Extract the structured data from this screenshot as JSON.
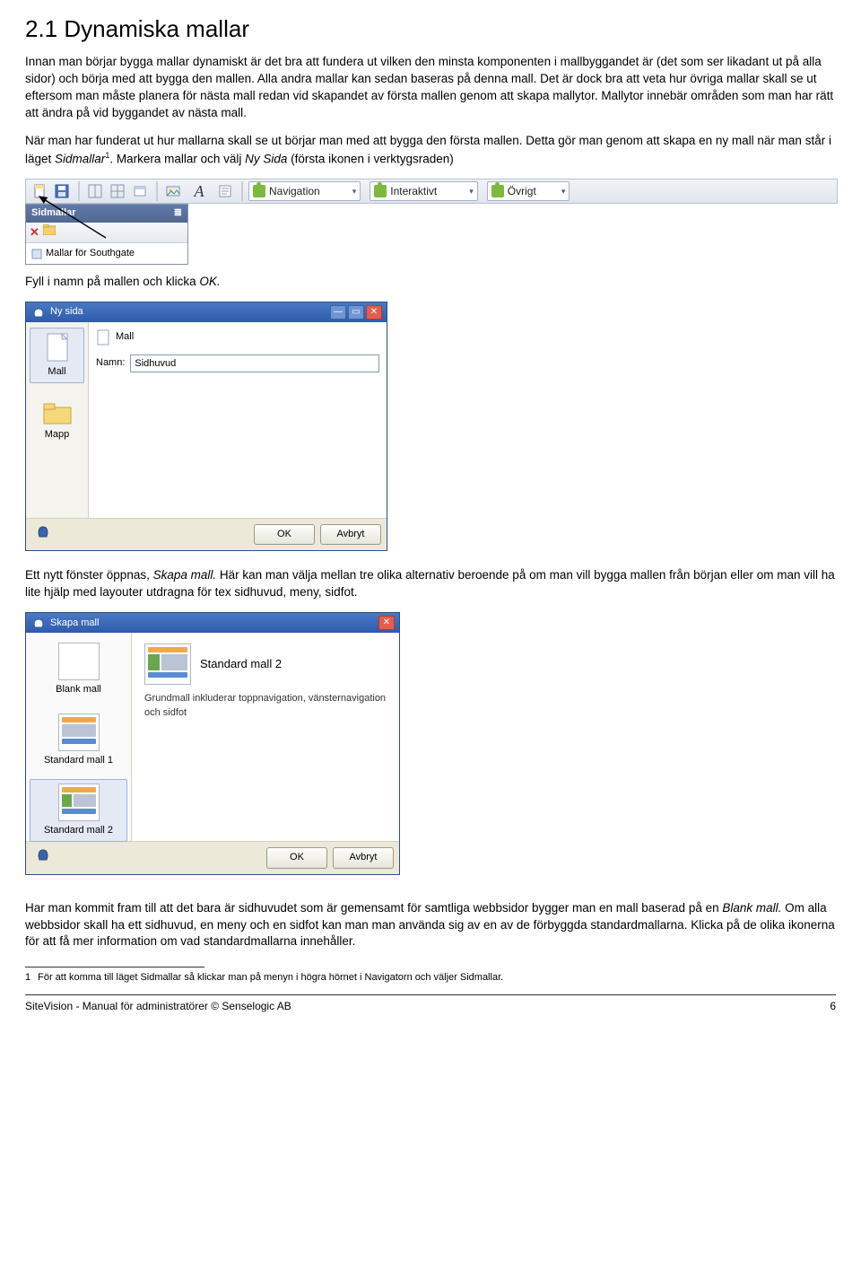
{
  "heading": "2.1 Dynamiska mallar",
  "para1": "Innan man börjar bygga mallar dynamiskt är det bra att fundera ut vilken den minsta komponenten i mallbyggandet är (det som ser likadant ut på alla sidor) och börja med att bygga den mallen. Alla andra mallar kan sedan baseras på denna mall. Det är dock bra att veta hur övriga mallar skall se ut eftersom man måste planera för nästa mall redan vid skapandet av första mallen genom att skapa mallytor. Mallytor innebär områden som man har rätt att ändra på vid byggandet av nästa mall.",
  "para2a": "När man har funderat ut hur mallarna skall se ut börjar man med att bygga den första mallen. Detta gör man genom att skapa en ny mall när man står i läget ",
  "para2b": "Sidmallar",
  "para2sup": "1",
  "para2c": ". Markera mallar och välj ",
  "para2d": "Ny Sida",
  "para2e": " (första ikonen i verktygsraden)",
  "toolbar": {
    "fontLetter": "A",
    "dd1": "Navigation",
    "dd2": "Interaktivt",
    "dd3": "Övrigt"
  },
  "panel": {
    "title": "Sidmallar",
    "item": "Mallar för Southgate"
  },
  "para3": "Fyll i namn på  mallen och klicka ",
  "para3b": "OK.",
  "nysida": {
    "title": "Ny sida",
    "leftMall": "Mall",
    "leftMapp": "Mapp",
    "rightHeader": "Mall",
    "nameLabel": "Namn:",
    "nameValue": "Sidhuvud",
    "ok": "OK",
    "cancel": "Avbryt"
  },
  "para4a": "Ett nytt fönster öppnas, ",
  "para4b": "Skapa mall.",
  "para4c": " Här kan man välja mellan tre olika alternativ beroende på om man vill bygga mallen från början eller om man vill ha lite hjälp med layouter utdragna för tex sidhuvud, meny, sidfot.",
  "skapa": {
    "title": "Skapa mall",
    "opt1": "Blank mall",
    "opt2": "Standard mall 1",
    "opt3": "Standard mall 2",
    "rightTitle": "Standard mall 2",
    "rightDesc": "Grundmall inkluderar toppnavigation, vänsternavigation och sidfot",
    "ok": "OK",
    "cancel": "Avbryt"
  },
  "para5a": "Har man kommit fram till att det bara är sidhuvudet som är gemensamt för samtliga webbsidor bygger man en mall baserad på en ",
  "para5b": "Blank mall.",
  "para5c": " Om alla webbsidor skall ha ett sidhuvud, en meny och en sidfot kan man man använda sig av en av de förbyggda standardmallarna. Klicka på de olika ikonerna för att få mer information om vad standardmallarna innehåller.",
  "footnote": {
    "num": "1",
    "text": "För att komma till läget Sidmallar så klickar man på menyn i högra hörnet i Navigatorn och väljer Sidmallar."
  },
  "footer": {
    "left": "SiteVision - Manual för administratörer © Senselogic AB",
    "right": "6"
  }
}
